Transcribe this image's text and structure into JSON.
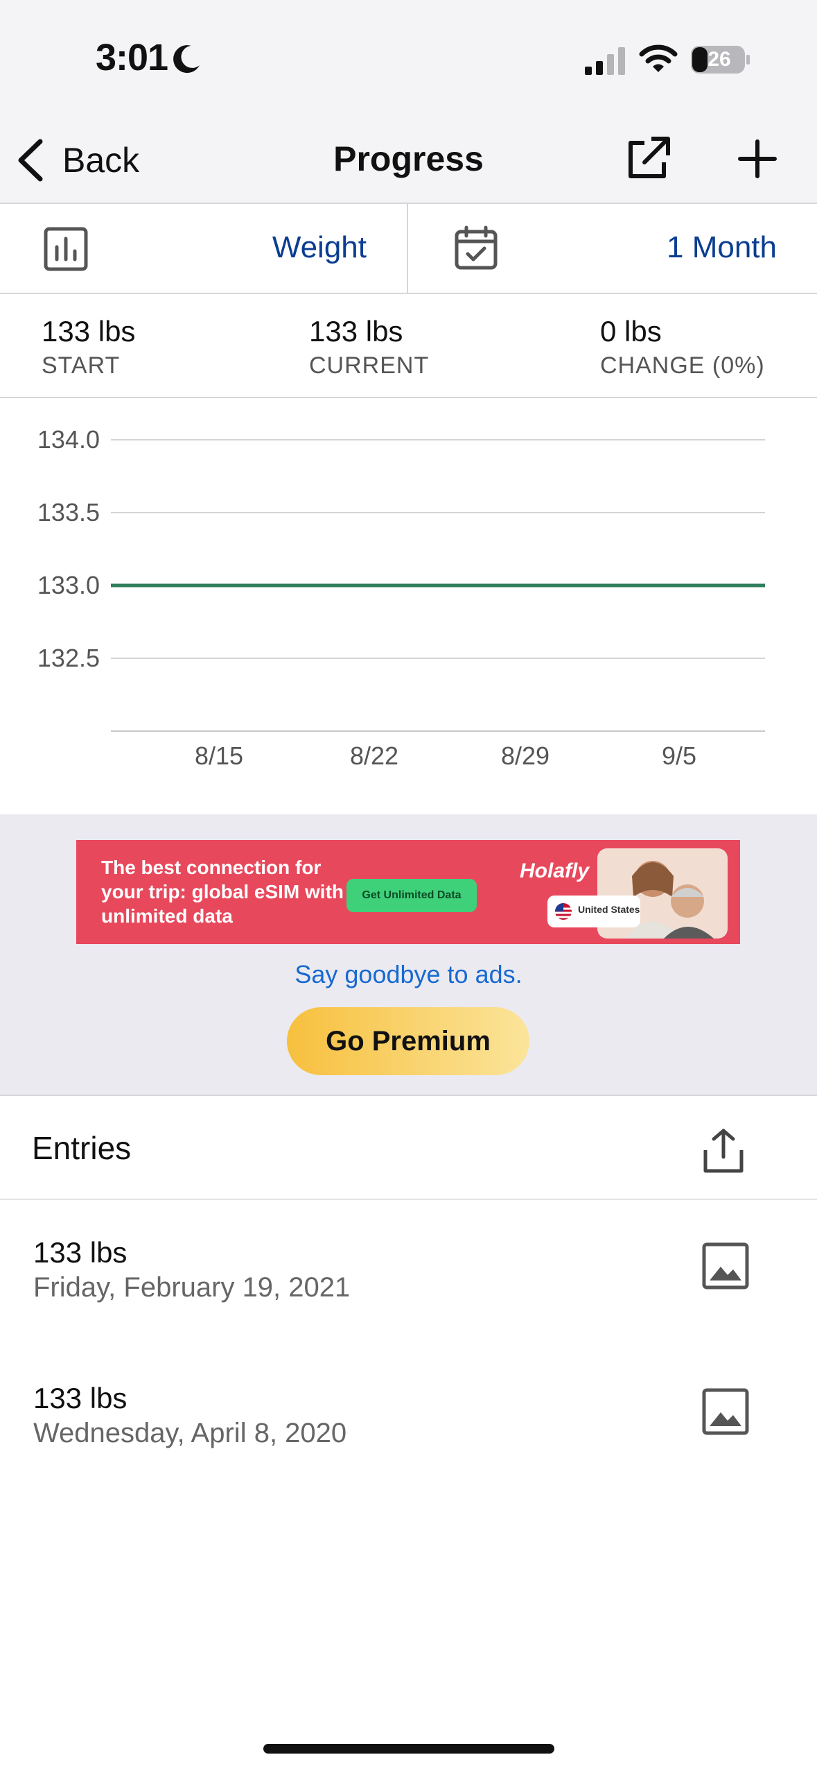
{
  "status_bar": {
    "time": "3:01",
    "battery_level": "26"
  },
  "nav": {
    "back_label": "Back",
    "title": "Progress"
  },
  "selectors": {
    "metric": "Weight",
    "range": "1 Month"
  },
  "stats": [
    {
      "value": "133 lbs",
      "label": "START"
    },
    {
      "value": "133 lbs",
      "label": "CURRENT"
    },
    {
      "value": "0 lbs",
      "label": "CHANGE (0%)"
    }
  ],
  "chart_data": {
    "type": "line",
    "x": [
      "8/15",
      "8/22",
      "8/29",
      "9/5"
    ],
    "series": [
      {
        "values": [
          133.0,
          133.0,
          133.0,
          133.0
        ],
        "color": "#2e7d5b"
      }
    ],
    "y_ticks": [
      "134.0",
      "133.5",
      "133.0",
      "132.5"
    ],
    "ylim": [
      132.0,
      134.0
    ],
    "grid": true
  },
  "ad": {
    "headline": "The best connection for your trip: global eSIM with unlimited data",
    "cta": "Get Unlimited Data",
    "brand": "Holafly",
    "pill_label": "United States"
  },
  "premium": {
    "link": "Say goodbye to ads.",
    "button": "Go Premium"
  },
  "entries": {
    "title": "Entries",
    "items": [
      {
        "value": "133 lbs",
        "date": "Friday, February 19, 2021"
      },
      {
        "value": "133 lbs",
        "date": "Wednesday, April 8, 2020"
      }
    ]
  },
  "colors": {
    "accent": "#0b3d91",
    "line": "#2e7d5b",
    "premium": "#f7c03e",
    "ad_background": "#e8485c"
  }
}
